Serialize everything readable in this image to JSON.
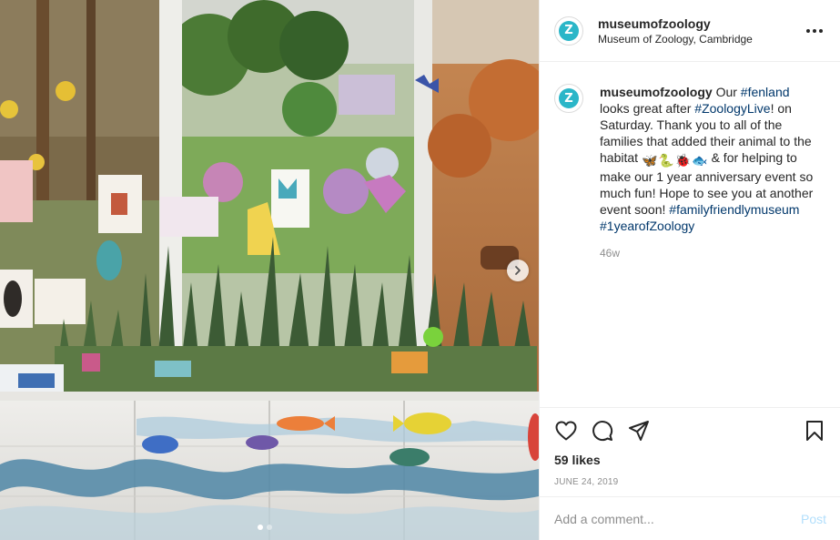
{
  "header": {
    "avatar_letter": "Z",
    "username": "museumofzoology",
    "location": "Museum of Zoology, Cambridge"
  },
  "caption": {
    "avatar_letter": "Z",
    "username": "museumofzoology",
    "text_1": "Our ",
    "tag_1": "#fenland",
    "text_2": " looks great after ",
    "tag_2": "#ZoologyLive",
    "text_3": "! on Saturday. Thank you to all of the families that added their animal to the habitat ",
    "emojis": [
      "🦋",
      "🐍",
      "🐞",
      "🐟"
    ],
    "text_4": " & for helping to make our 1 year anniversary event so much fun! Hope to see you at another event soon! ",
    "tag_3": "#familyfriendlymuseum",
    "tag_4": "#1yearofZoology",
    "age": "46w"
  },
  "actions": {
    "likes": "59 likes",
    "date": "June 24, 2019"
  },
  "comment": {
    "placeholder": "Add a comment...",
    "post_label": "Post"
  },
  "carousel": {
    "slide_count": 2,
    "active_slide": 1
  },
  "colors": {
    "brand_teal": "#2bb6c8",
    "hashtag": "#00376b",
    "post_disabled": "#b2dffc",
    "muted": "#8e8e8e"
  }
}
